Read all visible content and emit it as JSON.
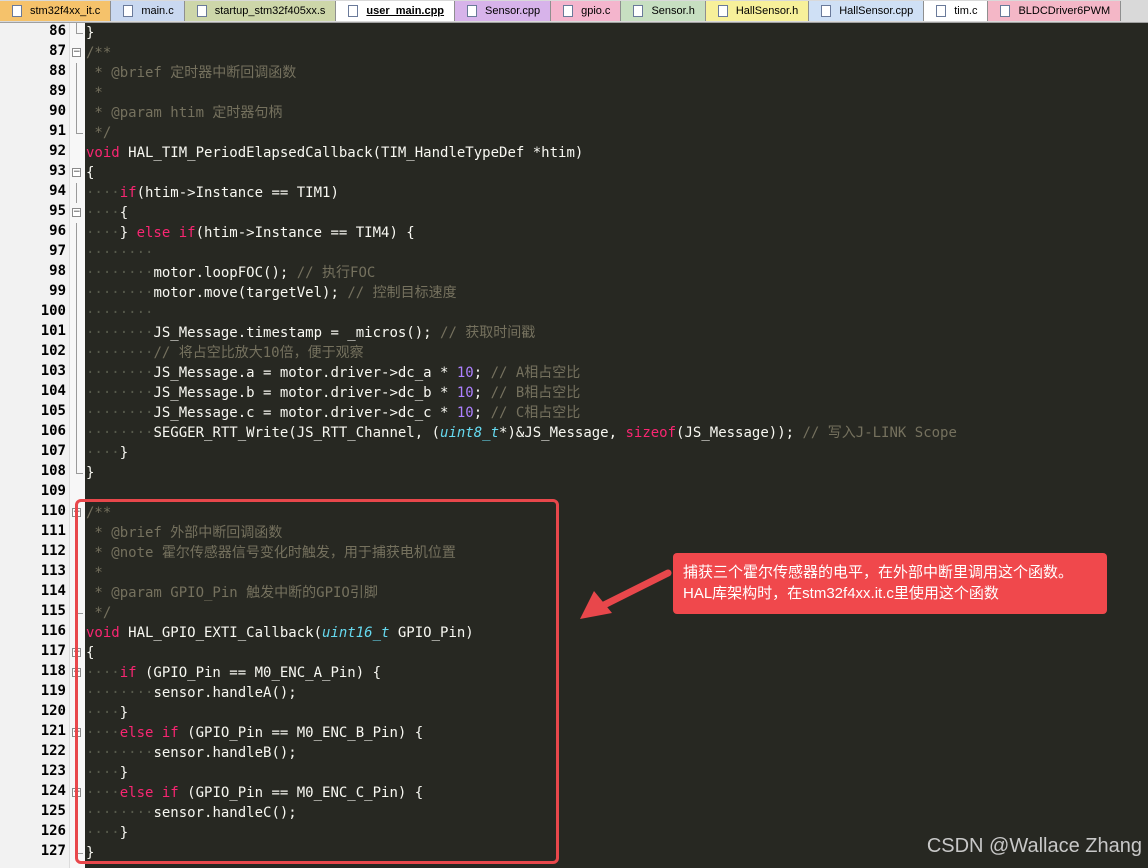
{
  "tabs": [
    {
      "label": "stm32f4xx_it.c",
      "color": "#f5c26b",
      "active": false
    },
    {
      "label": "main.c",
      "color": "#c9d8f0",
      "active": false
    },
    {
      "label": "startup_stm32f405xx.s",
      "color": "#cdd6a9",
      "active": false
    },
    {
      "label": "user_main.cpp",
      "color": "#ffffff",
      "active": true
    },
    {
      "label": "Sensor.cpp",
      "color": "#d7b3ea",
      "active": false
    },
    {
      "label": "gpio.c",
      "color": "#f4b5cd",
      "active": false
    },
    {
      "label": "Sensor.h",
      "color": "#c7dfc1",
      "active": false
    },
    {
      "label": "HallSensor.h",
      "color": "#f7f09a",
      "active": false
    },
    {
      "label": "HallSensor.cpp",
      "color": "#cfe0f5",
      "active": false
    },
    {
      "label": "tim.c",
      "color": "#ffffff",
      "active": false
    },
    {
      "label": "BLDCDriver6PWM",
      "color": "#f4b7c7",
      "active": false
    }
  ],
  "lines": [
    {
      "n": "86",
      "fold": "end",
      "toks": [
        [
          "",
          "}"
        ]
      ]
    },
    {
      "n": "87",
      "fold": "box",
      "toks": [
        [
          "c",
          "/**"
        ]
      ]
    },
    {
      "n": "88",
      "fold": "line",
      "toks": [
        [
          "c",
          " * @brief 定时器中断回调函数"
        ]
      ]
    },
    {
      "n": "89",
      "fold": "line",
      "toks": [
        [
          "c",
          " *"
        ]
      ]
    },
    {
      "n": "90",
      "fold": "line",
      "toks": [
        [
          "c",
          " * @param htim 定时器句柄"
        ]
      ]
    },
    {
      "n": "91",
      "fold": "end",
      "toks": [
        [
          "c",
          " */"
        ]
      ]
    },
    {
      "n": "92",
      "fold": "",
      "toks": [
        [
          "kw",
          "void"
        ],
        [
          "",
          " HAL_TIM_PeriodElapsedCallback(TIM_HandleTypeDef *htim)"
        ]
      ]
    },
    {
      "n": "93",
      "fold": "box",
      "toks": [
        [
          "",
          "{"
        ]
      ]
    },
    {
      "n": "94",
      "fold": "line",
      "toks": [
        [
          "ws",
          "····"
        ],
        [
          "kw",
          "if"
        ],
        [
          "",
          "(htim->Instance == TIM1)"
        ]
      ]
    },
    {
      "n": "95",
      "fold": "box",
      "toks": [
        [
          "ws",
          "····"
        ],
        [
          "",
          "{"
        ]
      ]
    },
    {
      "n": "96",
      "fold": "line",
      "toks": [
        [
          "ws",
          "····"
        ],
        [
          "",
          "} "
        ],
        [
          "kw",
          "else if"
        ],
        [
          "",
          "(htim->Instance == TIM4) {"
        ]
      ]
    },
    {
      "n": "97",
      "fold": "line",
      "toks": [
        [
          "ws",
          "········"
        ]
      ]
    },
    {
      "n": "98",
      "fold": "line",
      "toks": [
        [
          "ws",
          "········"
        ],
        [
          "",
          "motor.loopFOC(); "
        ],
        [
          "c",
          "// 执行FOC"
        ]
      ]
    },
    {
      "n": "99",
      "fold": "line",
      "toks": [
        [
          "ws",
          "········"
        ],
        [
          "",
          "motor.move(targetVel); "
        ],
        [
          "c",
          "// 控制目标速度"
        ]
      ]
    },
    {
      "n": "100",
      "fold": "line",
      "toks": [
        [
          "ws",
          "········"
        ]
      ]
    },
    {
      "n": "101",
      "fold": "line",
      "toks": [
        [
          "ws",
          "········"
        ],
        [
          "",
          "JS_Message.timestamp = _micros(); "
        ],
        [
          "c",
          "// 获取时间戳"
        ]
      ]
    },
    {
      "n": "102",
      "fold": "line",
      "toks": [
        [
          "ws",
          "········"
        ],
        [
          "c",
          "// 将占空比放大10倍，便于观察"
        ]
      ]
    },
    {
      "n": "103",
      "fold": "line",
      "toks": [
        [
          "ws",
          "········"
        ],
        [
          "",
          "JS_Message.a = motor.driver->dc_a * "
        ],
        [
          "nm",
          "10"
        ],
        [
          "",
          "; "
        ],
        [
          "c",
          "// A相占空比"
        ]
      ]
    },
    {
      "n": "104",
      "fold": "line",
      "toks": [
        [
          "ws",
          "········"
        ],
        [
          "",
          "JS_Message.b = motor.driver->dc_b * "
        ],
        [
          "nm",
          "10"
        ],
        [
          "",
          "; "
        ],
        [
          "c",
          "// B相占空比"
        ]
      ]
    },
    {
      "n": "105",
      "fold": "line",
      "toks": [
        [
          "ws",
          "········"
        ],
        [
          "",
          "JS_Message.c = motor.driver->dc_c * "
        ],
        [
          "nm",
          "10"
        ],
        [
          "",
          "; "
        ],
        [
          "c",
          "// C相占空比"
        ]
      ]
    },
    {
      "n": "106",
      "fold": "line",
      "toks": [
        [
          "ws",
          "········"
        ],
        [
          "",
          "SEGGER_RTT_Write(JS_RTT_Channel, ("
        ],
        [
          "ty",
          "uint8_t"
        ],
        [
          "",
          "*)&JS_Message, "
        ],
        [
          "kw",
          "sizeof"
        ],
        [
          "",
          "(JS_Message)); "
        ],
        [
          "c",
          "// 写入J-LINK Scope"
        ]
      ]
    },
    {
      "n": "107",
      "fold": "line",
      "toks": [
        [
          "ws",
          "····"
        ],
        [
          "",
          "}"
        ]
      ]
    },
    {
      "n": "108",
      "fold": "end",
      "toks": [
        [
          "",
          "}"
        ]
      ]
    },
    {
      "n": "109",
      "fold": "",
      "toks": []
    },
    {
      "n": "110",
      "fold": "box",
      "toks": [
        [
          "c",
          "/**"
        ]
      ]
    },
    {
      "n": "111",
      "fold": "line",
      "toks": [
        [
          "c",
          " * @brief 外部中断回调函数"
        ]
      ]
    },
    {
      "n": "112",
      "fold": "line",
      "toks": [
        [
          "c",
          " * @note 霍尔传感器信号变化时触发，用于捕获电机位置"
        ]
      ]
    },
    {
      "n": "113",
      "fold": "line",
      "toks": [
        [
          "c",
          " *"
        ]
      ]
    },
    {
      "n": "114",
      "fold": "line",
      "toks": [
        [
          "c",
          " * @param GPIO_Pin 触发中断的GPIO引脚"
        ]
      ]
    },
    {
      "n": "115",
      "fold": "end",
      "toks": [
        [
          "c",
          " */"
        ]
      ]
    },
    {
      "n": "116",
      "fold": "",
      "toks": [
        [
          "kw",
          "void"
        ],
        [
          "",
          " HAL_GPIO_EXTI_Callback("
        ],
        [
          "ty",
          "uint16_t"
        ],
        [
          "",
          " GPIO_Pin)"
        ]
      ]
    },
    {
      "n": "117",
      "fold": "box",
      "toks": [
        [
          "",
          "{"
        ]
      ]
    },
    {
      "n": "118",
      "fold": "box",
      "toks": [
        [
          "ws",
          "····"
        ],
        [
          "kw",
          "if"
        ],
        [
          "",
          " (GPIO_Pin == M0_ENC_A_Pin) {"
        ]
      ]
    },
    {
      "n": "119",
      "fold": "line",
      "toks": [
        [
          "ws",
          "········"
        ],
        [
          "",
          "sensor.handleA();"
        ]
      ]
    },
    {
      "n": "120",
      "fold": "line",
      "toks": [
        [
          "ws",
          "····"
        ],
        [
          "",
          "}"
        ]
      ]
    },
    {
      "n": "121",
      "fold": "box",
      "toks": [
        [
          "ws",
          "····"
        ],
        [
          "kw",
          "else if"
        ],
        [
          "",
          " (GPIO_Pin == M0_ENC_B_Pin) {"
        ]
      ]
    },
    {
      "n": "122",
      "fold": "line",
      "toks": [
        [
          "ws",
          "········"
        ],
        [
          "",
          "sensor.handleB();"
        ]
      ]
    },
    {
      "n": "123",
      "fold": "line",
      "toks": [
        [
          "ws",
          "····"
        ],
        [
          "",
          "}"
        ]
      ]
    },
    {
      "n": "124",
      "fold": "box",
      "toks": [
        [
          "ws",
          "····"
        ],
        [
          "kw",
          "else if"
        ],
        [
          "",
          " (GPIO_Pin == M0_ENC_C_Pin) {"
        ]
      ]
    },
    {
      "n": "125",
      "fold": "line",
      "toks": [
        [
          "ws",
          "········"
        ],
        [
          "",
          "sensor.handleC();"
        ]
      ]
    },
    {
      "n": "126",
      "fold": "line",
      "toks": [
        [
          "ws",
          "····"
        ],
        [
          "",
          "}"
        ]
      ]
    },
    {
      "n": "127",
      "fold": "end",
      "toks": [
        [
          "",
          "}"
        ]
      ]
    }
  ],
  "callout": {
    "line1": "捕获三个霍尔传感器的电平，在外部中断里调用这个函数。",
    "line2": "HAL库架构时，在stm32f4xx.it.c里使用这个函数"
  },
  "watermark": "CSDN @Wallace Zhang",
  "colors": {
    "annotation": "#f0484c",
    "editor_bg": "#272822"
  }
}
